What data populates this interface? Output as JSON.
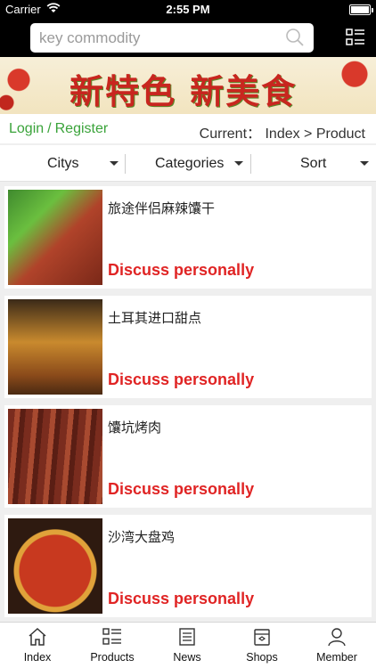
{
  "status": {
    "carrier": "Carrier",
    "time": "2:55 PM"
  },
  "search": {
    "placeholder": "key commodity",
    "icon": "search-icon",
    "menu_icon": "grid-menu-icon"
  },
  "banner": {
    "slogan": "新特色 新美食"
  },
  "account": {
    "login": "Login",
    "separator": "/",
    "register": "Register",
    "breadcrumb": "Current： Index > Product"
  },
  "filters": [
    {
      "label": "Citys"
    },
    {
      "label": "Categories"
    },
    {
      "label": "Sort"
    }
  ],
  "products": [
    {
      "name": "旅途伴侣麻辣馕干",
      "price": "Discuss personally"
    },
    {
      "name": "土耳其进口甜点",
      "price": "Discuss personally"
    },
    {
      "name": "馕坑烤肉",
      "price": "Discuss personally"
    },
    {
      "name": "沙湾大盘鸡",
      "price": "Discuss personally"
    }
  ],
  "tabs": [
    {
      "label": "Index",
      "icon": "home-icon"
    },
    {
      "label": "Products",
      "icon": "list-icon"
    },
    {
      "label": "News",
      "icon": "newspaper-icon"
    },
    {
      "label": "Shops",
      "icon": "shop-icon"
    },
    {
      "label": "Member",
      "icon": "person-icon"
    }
  ],
  "colors": {
    "accent_green": "#3aa33a",
    "price_red": "#e02424",
    "header_bg": "#000000"
  }
}
